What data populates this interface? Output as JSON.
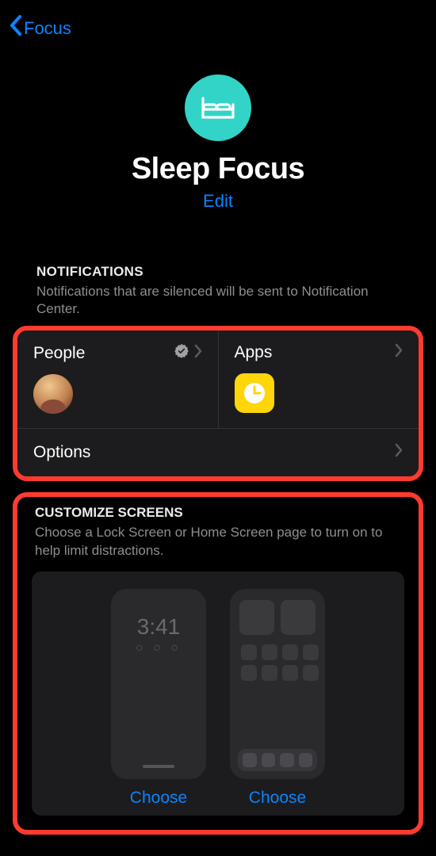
{
  "nav": {
    "back_label": "Focus"
  },
  "hero": {
    "icon": "bed-icon",
    "title": "Sleep Focus",
    "edit_label": "Edit"
  },
  "notifications": {
    "header": "Notifications",
    "description": "Notifications that are silenced will be sent to Notification Center.",
    "people": {
      "title": "People",
      "verified": true
    },
    "apps": {
      "title": "Apps",
      "app_icon": "clock-app"
    },
    "options": {
      "title": "Options"
    }
  },
  "customize_screens": {
    "header": "Customize Screens",
    "description": "Choose a Lock Screen or Home Screen page to turn on to help limit distractions.",
    "lock_screen": {
      "time": "3:41",
      "choose_label": "Choose"
    },
    "home_screen": {
      "choose_label": "Choose"
    }
  },
  "colors": {
    "accent": "#0a84ff",
    "highlight_border": "#ff3b30",
    "focus_icon_bg": "#32d4c7"
  }
}
